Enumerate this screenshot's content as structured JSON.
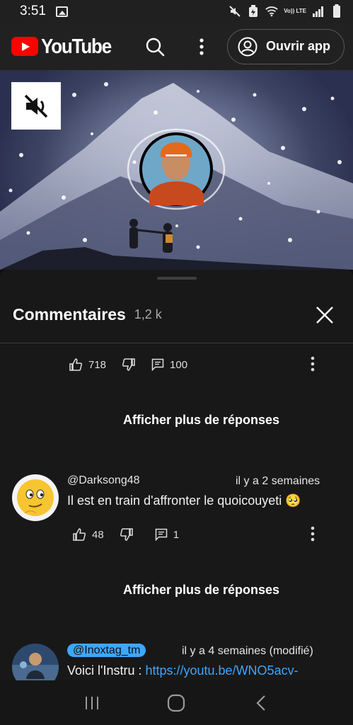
{
  "status_bar": {
    "time": "3:51",
    "network": "Vo)) LTE"
  },
  "app_bar": {
    "logo_text": "YouTube",
    "open_app_label": "Ouvrir app"
  },
  "sheet": {
    "title": "Commentaires",
    "count": "1,2 k"
  },
  "thread_top": {
    "likes": "718",
    "replies": "100",
    "show_more": "Afficher plus de réponses"
  },
  "comments": [
    {
      "author": "@Darksong48",
      "time": "il y a 2 semaines",
      "text": "Il est en train d'affronter le quoicouyeti 🥺",
      "likes": "48",
      "replies": "1",
      "show_more": "Afficher plus de réponses"
    },
    {
      "author": "@Inoxtag_tm",
      "time": "il y a 4 semaines (modifié)",
      "text_prefix": "Voici l'Instru : ",
      "link": "https://youtu.be/WNO5acv-"
    }
  ],
  "colors": {
    "accent_red": "#ff0000",
    "link_blue": "#3ea6ff",
    "background": "#0f0f0f",
    "sheet": "#181818"
  }
}
